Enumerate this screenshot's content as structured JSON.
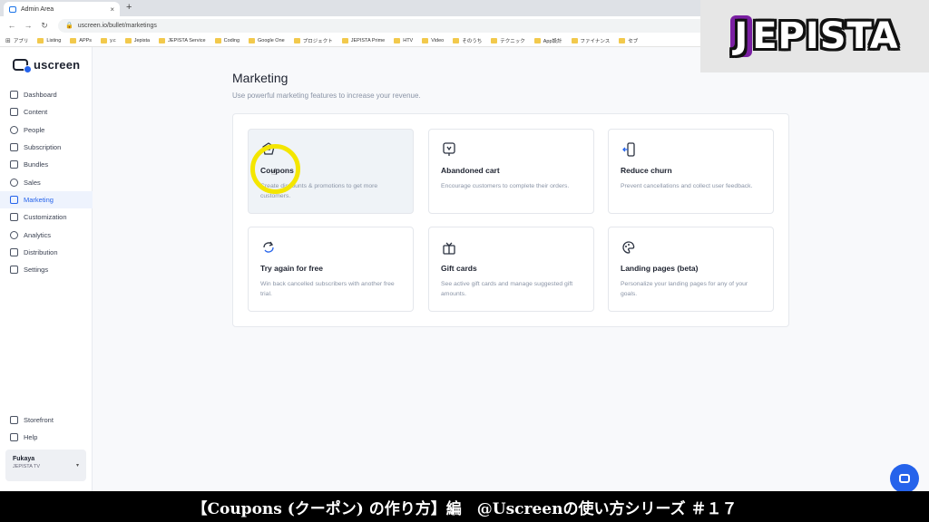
{
  "browser": {
    "tab_title": "Admin Area",
    "tab_close": "×",
    "new_tab": "+",
    "url": "uscreen.io/bullet/marketings",
    "bookmarks": [
      "アプリ",
      "Listing",
      "APPs",
      "y.c",
      "Jepista",
      "JEPISTA Service",
      "Coding",
      "Google One",
      "プロジェクト",
      "JEPISTA Prime",
      "HTV",
      "Video",
      "そのうち",
      "テクニック",
      "App設計",
      "ファイナンス",
      "セブ"
    ]
  },
  "sidebar": {
    "logo": "uscreen",
    "items": [
      {
        "label": "Dashboard"
      },
      {
        "label": "Content"
      },
      {
        "label": "People"
      },
      {
        "label": "Subscription"
      },
      {
        "label": "Bundles"
      },
      {
        "label": "Sales"
      },
      {
        "label": "Marketing",
        "active": true
      },
      {
        "label": "Customization"
      },
      {
        "label": "Analytics"
      },
      {
        "label": "Distribution"
      },
      {
        "label": "Settings"
      }
    ],
    "bottom": [
      {
        "label": "Storefront"
      },
      {
        "label": "Help"
      }
    ],
    "user": {
      "name": "Fukaya",
      "org": "JEPISTA TV"
    }
  },
  "main": {
    "title": "Marketing",
    "subtitle": "Use powerful marketing features to increase your revenue.",
    "cards": [
      {
        "title": "Coupons",
        "desc": "Create discounts & promotions to get more customers.",
        "icon": "coupon-icon"
      },
      {
        "title": "Abandoned cart",
        "desc": "Encourage customers to complete their orders.",
        "icon": "cart-icon"
      },
      {
        "title": "Reduce churn",
        "desc": "Prevent cancellations and collect user feedback.",
        "icon": "churn-icon"
      },
      {
        "title": "Try again for free",
        "desc": "Win back cancelled subscribers with another free trial.",
        "icon": "retry-icon"
      },
      {
        "title": "Gift cards",
        "desc": "See active gift cards and manage suggested gift amounts.",
        "icon": "gift-icon"
      },
      {
        "title": "Landing pages (beta)",
        "desc": "Personalize your landing pages for any of your goals.",
        "icon": "palette-icon"
      }
    ]
  },
  "overlay": {
    "brand": "JEPISTA",
    "caption": "【Coupons (クーポン) の作り方】編　@Uscreenの使い方シリーズ ＃１７"
  },
  "colors": {
    "accent": "#2563eb",
    "highlight": "#f4e600",
    "brand_purple": "#7a1fa2"
  }
}
